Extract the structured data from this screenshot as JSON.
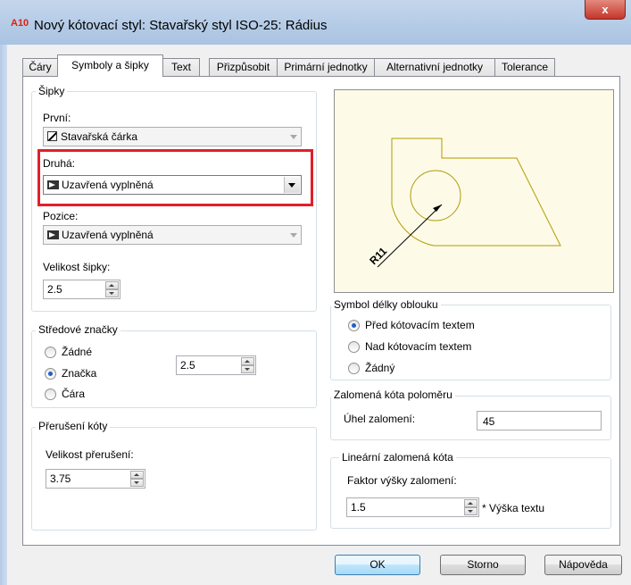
{
  "window": {
    "app_icon": "A10",
    "title": "Nový kótovací styl: Stavařský styl ISO-25: Rádius",
    "close_label": "x"
  },
  "tabs": [
    {
      "label": "Čáry"
    },
    {
      "label": "Symboly a šipky"
    },
    {
      "label": "Text"
    },
    {
      "label": "Přizpůsobit"
    },
    {
      "label": "Primární jednotky"
    },
    {
      "label": "Alternativní jednotky"
    },
    {
      "label": "Tolerance"
    }
  ],
  "arrows": {
    "group_label": "Šipky",
    "first_label": "První:",
    "first_value": "Stavařská čárka",
    "second_label": "Druhá:",
    "second_value": "Uzavřená vyplněná",
    "position_label": "Pozice:",
    "position_value": "Uzavřená vyplněná",
    "size_label": "Velikost šipky:",
    "size_value": "2.5"
  },
  "center_marks": {
    "group_label": "Středové značky",
    "options": [
      "Žádné",
      "Značka",
      "Čára"
    ],
    "selected": "Značka",
    "value": "2.5"
  },
  "break": {
    "group_label": "Přerušení kóty",
    "size_label": "Velikost přerušení:",
    "size_value": "3.75"
  },
  "preview": {
    "dimension_label": "R11"
  },
  "arc_symbol": {
    "group_label": "Symbol délky oblouku",
    "options": [
      "Před kótovacím textem",
      "Nad kótovacím textem",
      "Žádný"
    ],
    "selected": "Před kótovacím textem"
  },
  "jogged_radius": {
    "group_label": "Zalomená kóta poloměru",
    "angle_label": "Úhel zalomení:",
    "angle_value": "45"
  },
  "linear_jog": {
    "group_label": "Lineární zalomená kóta",
    "factor_label": "Faktor výšky zalomení:",
    "factor_value": "1.5",
    "suffix": "* Výška textu"
  },
  "buttons": {
    "ok": "OK",
    "cancel": "Storno",
    "help": "Nápověda"
  },
  "colors": {
    "highlight": "#e0202a",
    "preview_bg": "#fdfbe8",
    "preview_stroke": "#b39a00"
  }
}
